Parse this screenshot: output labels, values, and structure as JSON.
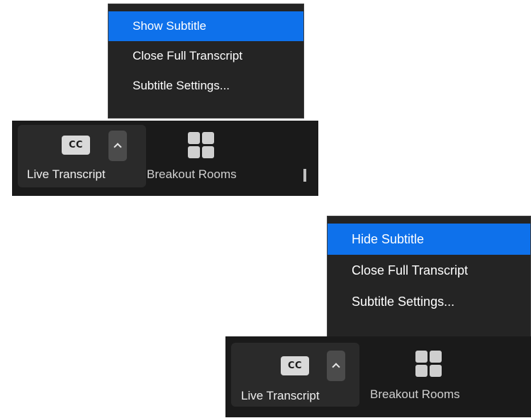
{
  "panels": [
    {
      "menu": {
        "items": [
          {
            "label": "Show Subtitle",
            "active": true
          },
          {
            "label": "Close Full Transcript",
            "active": false
          },
          {
            "label": "Subtitle Settings...",
            "active": false
          }
        ]
      },
      "toolbar": {
        "live_transcript": {
          "icon_text": "CC",
          "label": "Live Transcript"
        },
        "breakout_rooms": {
          "label": "Breakout Rooms"
        }
      }
    },
    {
      "menu": {
        "items": [
          {
            "label": "Hide Subtitle",
            "active": true
          },
          {
            "label": "Close Full Transcript",
            "active": false
          },
          {
            "label": "Subtitle Settings...",
            "active": false
          }
        ]
      },
      "toolbar": {
        "live_transcript": {
          "icon_text": "CC",
          "label": "Live Transcript"
        },
        "breakout_rooms": {
          "label": "Breakout Rooms"
        }
      }
    }
  ],
  "colors": {
    "menu_bg": "#242424",
    "menu_active": "#0e71eb",
    "toolbar_bg": "#1a1a1a",
    "text": "#ffffff"
  }
}
